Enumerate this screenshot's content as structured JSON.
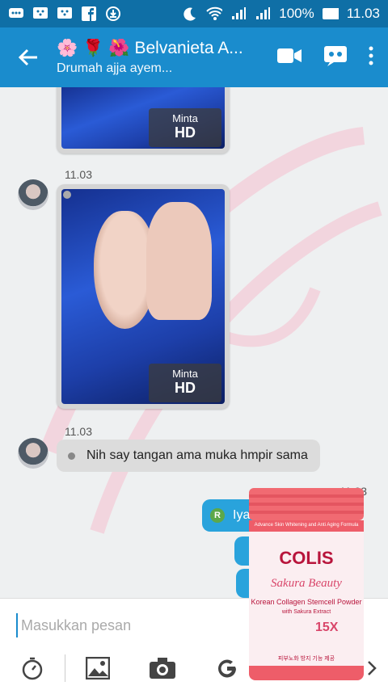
{
  "status_bar": {
    "battery": "100%",
    "time": "11.03"
  },
  "header": {
    "title": "Belvanieta A...",
    "subtitle": "Drumah ajja ayem...",
    "emojis": [
      "🌸",
      "🌹",
      "🌺"
    ]
  },
  "messages": {
    "photo1": {
      "hd_small": "Minta",
      "hd_big": "HD"
    },
    "time1": "11.03",
    "photo2": {
      "hd_small": "Minta",
      "hd_big": "HD"
    },
    "time2": "11.03",
    "text_in": "Nih say tangan ama muka hmpir sama",
    "time3": "11.03",
    "text_out": "Iya",
    "badge": "R"
  },
  "product": {
    "tagline": "Advance Skin Whitening and Anti Aging Formula",
    "brand": "COLIS",
    "line": "Sakura Beauty",
    "desc": "Korean Collagen Stemcell Powder",
    "with": "with Sakura Extract",
    "mult": "15X",
    "korean": "피부노화 방지 기능 제공"
  },
  "input": {
    "placeholder": "Masukkan pesan"
  },
  "colors": {
    "status_bar": "#0f6fa6",
    "app_bar": "#1a8ccd",
    "outgoing": "#29a3dc",
    "incoming": "#dcdcdc"
  }
}
